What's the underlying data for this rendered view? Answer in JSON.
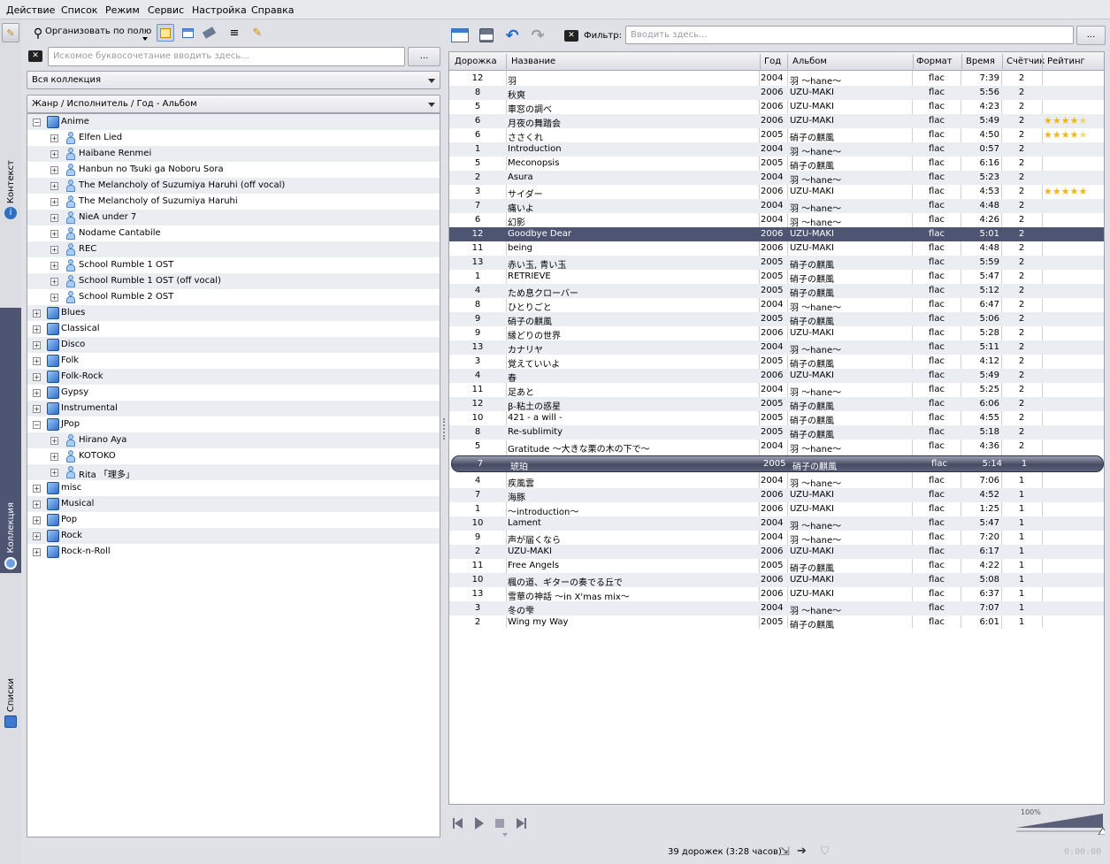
{
  "menu": [
    "Действие",
    "Список",
    "Режим",
    "Сервис",
    "Настройка",
    "Справка"
  ],
  "sidetabs": {
    "context": "Контекст",
    "collection": "Коллекция",
    "playlists": "Списки"
  },
  "left": {
    "organize_label": "Организовать по полю",
    "search_placeholder": "Искомое буквосочетание вводить здесь...",
    "more_button": "...",
    "collection_select": "Вся коллекция",
    "grouping_select": "Жанр / Исполнитель / Год - Альбом"
  },
  "tree": [
    {
      "label": "Anime",
      "level": 0,
      "expanded": true
    },
    {
      "label": "Elfen Lied",
      "level": 1
    },
    {
      "label": "Haibane Renmei",
      "level": 1
    },
    {
      "label": "Hanbun no Tsuki ga Noboru Sora",
      "level": 1
    },
    {
      "label": "The Melancholy of Suzumiya Haruhi (off vocal)",
      "level": 1
    },
    {
      "label": "The Melancholy of Suzumiya Haruhi",
      "level": 1
    },
    {
      "label": "NieA under 7",
      "level": 1
    },
    {
      "label": "Nodame Cantabile",
      "level": 1
    },
    {
      "label": "REC",
      "level": 1
    },
    {
      "label": "School Rumble 1 OST",
      "level": 1
    },
    {
      "label": "School Rumble 1 OST (off vocal)",
      "level": 1
    },
    {
      "label": "School Rumble 2 OST",
      "level": 1
    },
    {
      "label": "Blues",
      "level": 0
    },
    {
      "label": "Classical",
      "level": 0
    },
    {
      "label": "Disco",
      "level": 0
    },
    {
      "label": "Folk",
      "level": 0
    },
    {
      "label": "Folk-Rock",
      "level": 0
    },
    {
      "label": "Gypsy",
      "level": 0
    },
    {
      "label": "Instrumental",
      "level": 0
    },
    {
      "label": "JPop",
      "level": 0,
      "expanded": true
    },
    {
      "label": "Hirano Aya",
      "level": 1
    },
    {
      "label": "KOTOKO",
      "level": 1
    },
    {
      "label": "Rita 「理多」",
      "level": 1
    },
    {
      "label": "misc",
      "level": 0
    },
    {
      "label": "Musical",
      "level": 0
    },
    {
      "label": "Pop",
      "level": 0
    },
    {
      "label": "Rock",
      "level": 0
    },
    {
      "label": "Rock-n-Roll",
      "level": 0
    }
  ],
  "filter": {
    "label": "Фильтр:",
    "placeholder": "Вводить здесь...",
    "more": "..."
  },
  "playlist": {
    "columns": [
      "Дорожка",
      "Название",
      "Год",
      "Альбом",
      "Формат",
      "Время",
      "Счётчик",
      "Рейтинг"
    ],
    "rows": [
      {
        "track": "12",
        "title": "羽",
        "year": "2004",
        "album": "羽 ～hane～",
        "format": "flac",
        "time": "7:39",
        "count": "2",
        "rating": 0
      },
      {
        "track": "8",
        "title": "秋爽",
        "year": "2006",
        "album": "UZU-MAKI",
        "format": "flac",
        "time": "5:56",
        "count": "2",
        "rating": 0
      },
      {
        "track": "5",
        "title": "車窓の調べ",
        "year": "2006",
        "album": "UZU-MAKI",
        "format": "flac",
        "time": "4:23",
        "count": "2",
        "rating": 0
      },
      {
        "track": "6",
        "title": "月夜の舞踏会",
        "year": "2006",
        "album": "UZU-MAKI",
        "format": "flac",
        "time": "5:49",
        "count": "2",
        "rating": 4.5
      },
      {
        "track": "6",
        "title": "ささくれ",
        "year": "2005",
        "album": "硝子の麒風",
        "format": "flac",
        "time": "4:50",
        "count": "2",
        "rating": 4.5
      },
      {
        "track": "1",
        "title": "Introduction",
        "year": "2004",
        "album": "羽 ～hane～",
        "format": "flac",
        "time": "0:57",
        "count": "2",
        "rating": 0
      },
      {
        "track": "5",
        "title": "Meconopsis",
        "year": "2005",
        "album": "硝子の麒風",
        "format": "flac",
        "time": "6:16",
        "count": "2",
        "rating": 0
      },
      {
        "track": "2",
        "title": "Asura",
        "year": "2004",
        "album": "羽 ～hane～",
        "format": "flac",
        "time": "5:23",
        "count": "2",
        "rating": 0
      },
      {
        "track": "3",
        "title": "サイダー",
        "year": "2006",
        "album": "UZU-MAKI",
        "format": "flac",
        "time": "4:53",
        "count": "2",
        "rating": 5
      },
      {
        "track": "7",
        "title": "痛いよ",
        "year": "2004",
        "album": "羽 ～hane～",
        "format": "flac",
        "time": "4:48",
        "count": "2",
        "rating": 0
      },
      {
        "track": "6",
        "title": "幻影",
        "year": "2004",
        "album": "羽 ～hane～",
        "format": "flac",
        "time": "4:26",
        "count": "2",
        "rating": 0
      },
      {
        "track": "12",
        "title": "Goodbye Dear",
        "year": "2006",
        "album": "UZU-MAKI",
        "format": "flac",
        "time": "5:01",
        "count": "2",
        "rating": 0
      },
      {
        "track": "11",
        "title": "being",
        "year": "2006",
        "album": "UZU-MAKI",
        "format": "flac",
        "time": "4:48",
        "count": "2",
        "rating": 0
      },
      {
        "track": "13",
        "title": "赤い玉, 青い玉",
        "year": "2005",
        "album": "硝子の麒風",
        "format": "flac",
        "time": "5:59",
        "count": "2",
        "rating": 0
      },
      {
        "track": "1",
        "title": "RETRIEVE",
        "year": "2005",
        "album": "硝子の麒風",
        "format": "flac",
        "time": "5:47",
        "count": "2",
        "rating": 0
      },
      {
        "track": "4",
        "title": "ため息クローバー",
        "year": "2005",
        "album": "硝子の麒風",
        "format": "flac",
        "time": "5:12",
        "count": "2",
        "rating": 0
      },
      {
        "track": "8",
        "title": "ひとりごと",
        "year": "2004",
        "album": "羽 ～hane～",
        "format": "flac",
        "time": "6:47",
        "count": "2",
        "rating": 0
      },
      {
        "track": "9",
        "title": "硝子の麒風",
        "year": "2005",
        "album": "硝子の麒風",
        "format": "flac",
        "time": "5:06",
        "count": "2",
        "rating": 0
      },
      {
        "track": "9",
        "title": "縁どりの世界",
        "year": "2006",
        "album": "UZU-MAKI",
        "format": "flac",
        "time": "5:28",
        "count": "2",
        "rating": 0
      },
      {
        "track": "13",
        "title": "カナリヤ",
        "year": "2004",
        "album": "羽 ～hane～",
        "format": "flac",
        "time": "5:11",
        "count": "2",
        "rating": 0
      },
      {
        "track": "3",
        "title": "覚えていいよ",
        "year": "2005",
        "album": "硝子の麒風",
        "format": "flac",
        "time": "4:12",
        "count": "2",
        "rating": 0
      },
      {
        "track": "4",
        "title": "春",
        "year": "2006",
        "album": "UZU-MAKI",
        "format": "flac",
        "time": "5:49",
        "count": "2",
        "rating": 0
      },
      {
        "track": "11",
        "title": "足あと",
        "year": "2004",
        "album": "羽 ～hane～",
        "format": "flac",
        "time": "5:25",
        "count": "2",
        "rating": 0
      },
      {
        "track": "12",
        "title": "β-粘土の惑星",
        "year": "2005",
        "album": "硝子の麒風",
        "format": "flac",
        "time": "6:06",
        "count": "2",
        "rating": 0
      },
      {
        "track": "10",
        "title": "421 - a will -",
        "year": "2005",
        "album": "硝子の麒風",
        "format": "flac",
        "time": "4:55",
        "count": "2",
        "rating": 0
      },
      {
        "track": "8",
        "title": "Re-sublimity",
        "year": "2005",
        "album": "硝子の麒風",
        "format": "flac",
        "time": "5:18",
        "count": "2",
        "rating": 0
      },
      {
        "track": "5",
        "title": "Gratitude ～大きな栗の木の下で～",
        "year": "2004",
        "album": "羽 ～hane～",
        "format": "flac",
        "time": "4:36",
        "count": "2",
        "rating": 0
      },
      {
        "track": "7",
        "title": "琥珀",
        "year": "2005",
        "album": "硝子の麒風",
        "format": "flac",
        "time": "5:14",
        "count": "1",
        "rating": 0
      },
      {
        "track": "4",
        "title": "疾風雲",
        "year": "2004",
        "album": "羽 ～hane～",
        "format": "flac",
        "time": "7:06",
        "count": "1",
        "rating": 0
      },
      {
        "track": "7",
        "title": "海豚",
        "year": "2006",
        "album": "UZU-MAKI",
        "format": "flac",
        "time": "4:52",
        "count": "1",
        "rating": 0
      },
      {
        "track": "1",
        "title": "～introduction～",
        "year": "2006",
        "album": "UZU-MAKI",
        "format": "flac",
        "time": "1:25",
        "count": "1",
        "rating": 0
      },
      {
        "track": "10",
        "title": "Lament",
        "year": "2004",
        "album": "羽 ～hane～",
        "format": "flac",
        "time": "5:47",
        "count": "1",
        "rating": 0
      },
      {
        "track": "9",
        "title": "声が届くなら",
        "year": "2004",
        "album": "羽 ～hane～",
        "format": "flac",
        "time": "7:20",
        "count": "1",
        "rating": 0
      },
      {
        "track": "2",
        "title": "UZU-MAKI",
        "year": "2006",
        "album": "UZU-MAKI",
        "format": "flac",
        "time": "6:17",
        "count": "1",
        "rating": 0
      },
      {
        "track": "11",
        "title": "Free Angels",
        "year": "2005",
        "album": "硝子の麒風",
        "format": "flac",
        "time": "4:22",
        "count": "1",
        "rating": 0
      },
      {
        "track": "10",
        "title": "楓の道、ギターの奏でる丘で",
        "year": "2006",
        "album": "UZU-MAKI",
        "format": "flac",
        "time": "5:08",
        "count": "1",
        "rating": 0
      },
      {
        "track": "13",
        "title": "雪華の神話 ～in X'mas mix～",
        "year": "2006",
        "album": "UZU-MAKI",
        "format": "flac",
        "time": "6:37",
        "count": "1",
        "rating": 0
      },
      {
        "track": "3",
        "title": "冬の雫",
        "year": "2004",
        "album": "羽 ～hane～",
        "format": "flac",
        "time": "7:07",
        "count": "1",
        "rating": 0
      },
      {
        "track": "2",
        "title": "Wing my Way",
        "year": "2005",
        "album": "硝子の麒風",
        "format": "flac",
        "time": "6:01",
        "count": "1",
        "rating": 0
      }
    ],
    "selected_index": 11,
    "current_index": 27
  },
  "volume": {
    "label": "100%",
    "level": 1.0
  },
  "status": {
    "summary": "39 дорожек (3:28 часов)",
    "time": "0:00:00"
  },
  "colors": {
    "selection": "#4d5573",
    "star": "#f2b708"
  }
}
